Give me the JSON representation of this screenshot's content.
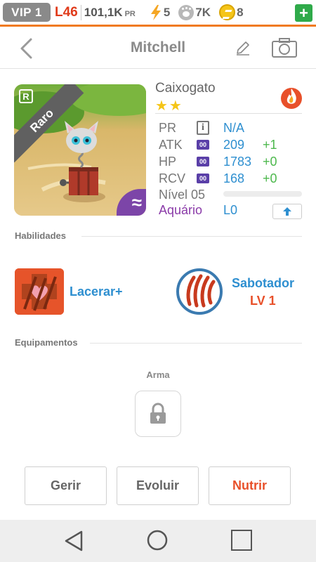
{
  "topbar": {
    "vip": "VIP 1",
    "level": "L46",
    "power": "101,1K",
    "power_unit": "PR",
    "energy": "5",
    "paws": "7K",
    "coins": "8",
    "add_label": "+"
  },
  "header": {
    "title": "Mitchell"
  },
  "card": {
    "rarity": "Raro",
    "rarity_badge": "R",
    "element_glyph": "≈"
  },
  "pet": {
    "species": "Caixogato",
    "stars": "★★",
    "stats": [
      {
        "label": "PR",
        "value": "N/A",
        "delta": ""
      },
      {
        "label": "ATK",
        "badge": "00",
        "value": "209",
        "delta": "+1"
      },
      {
        "label": "HP",
        "badge": "00",
        "value": "1783",
        "delta": "+0"
      },
      {
        "label": "RCV",
        "badge": "00",
        "value": "168",
        "delta": "+0"
      }
    ],
    "level_label": "Nível 05",
    "level_progress": 0,
    "habitat": "Aquário",
    "habitat_level": "L0"
  },
  "sections": {
    "abilities": "Habilidades",
    "equipment": "Equipamentos",
    "weapon": "Arma"
  },
  "abilities": [
    {
      "name": "Lacerar+",
      "level": ""
    },
    {
      "name": "Sabotador",
      "level": "LV 1"
    }
  ],
  "actions": {
    "manage": "Gerir",
    "evolve": "Evoluir",
    "feed": "Nutrir"
  },
  "colors": {
    "accent": "#f07a20",
    "value_blue": "#2e8fd0",
    "delta_green": "#4cb84c",
    "feed_orange": "#e8502a"
  }
}
